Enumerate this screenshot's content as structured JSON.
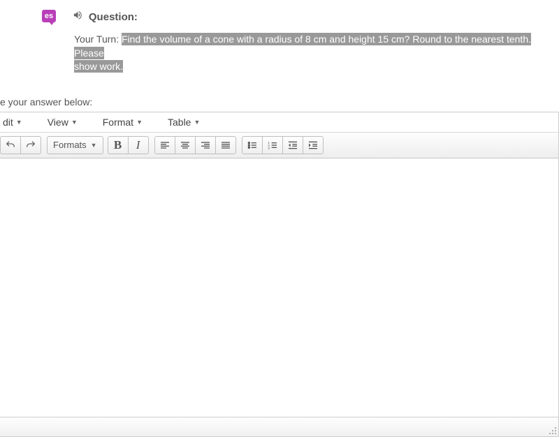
{
  "badge": {
    "label": "es"
  },
  "question": {
    "label": "Question:",
    "prefix": "Your Turn:",
    "highlighted_line1": "Find the volume of a cone with a radius of 8 cm and height 15 cm? Round to the nearest tenth. Please",
    "highlighted_line2": "show work."
  },
  "answer_prompt": "e your answer below:",
  "menubar": {
    "edit": "dit",
    "view": "View",
    "format": "Format",
    "table": "Table"
  },
  "toolbar": {
    "formats_label": "Formats"
  }
}
